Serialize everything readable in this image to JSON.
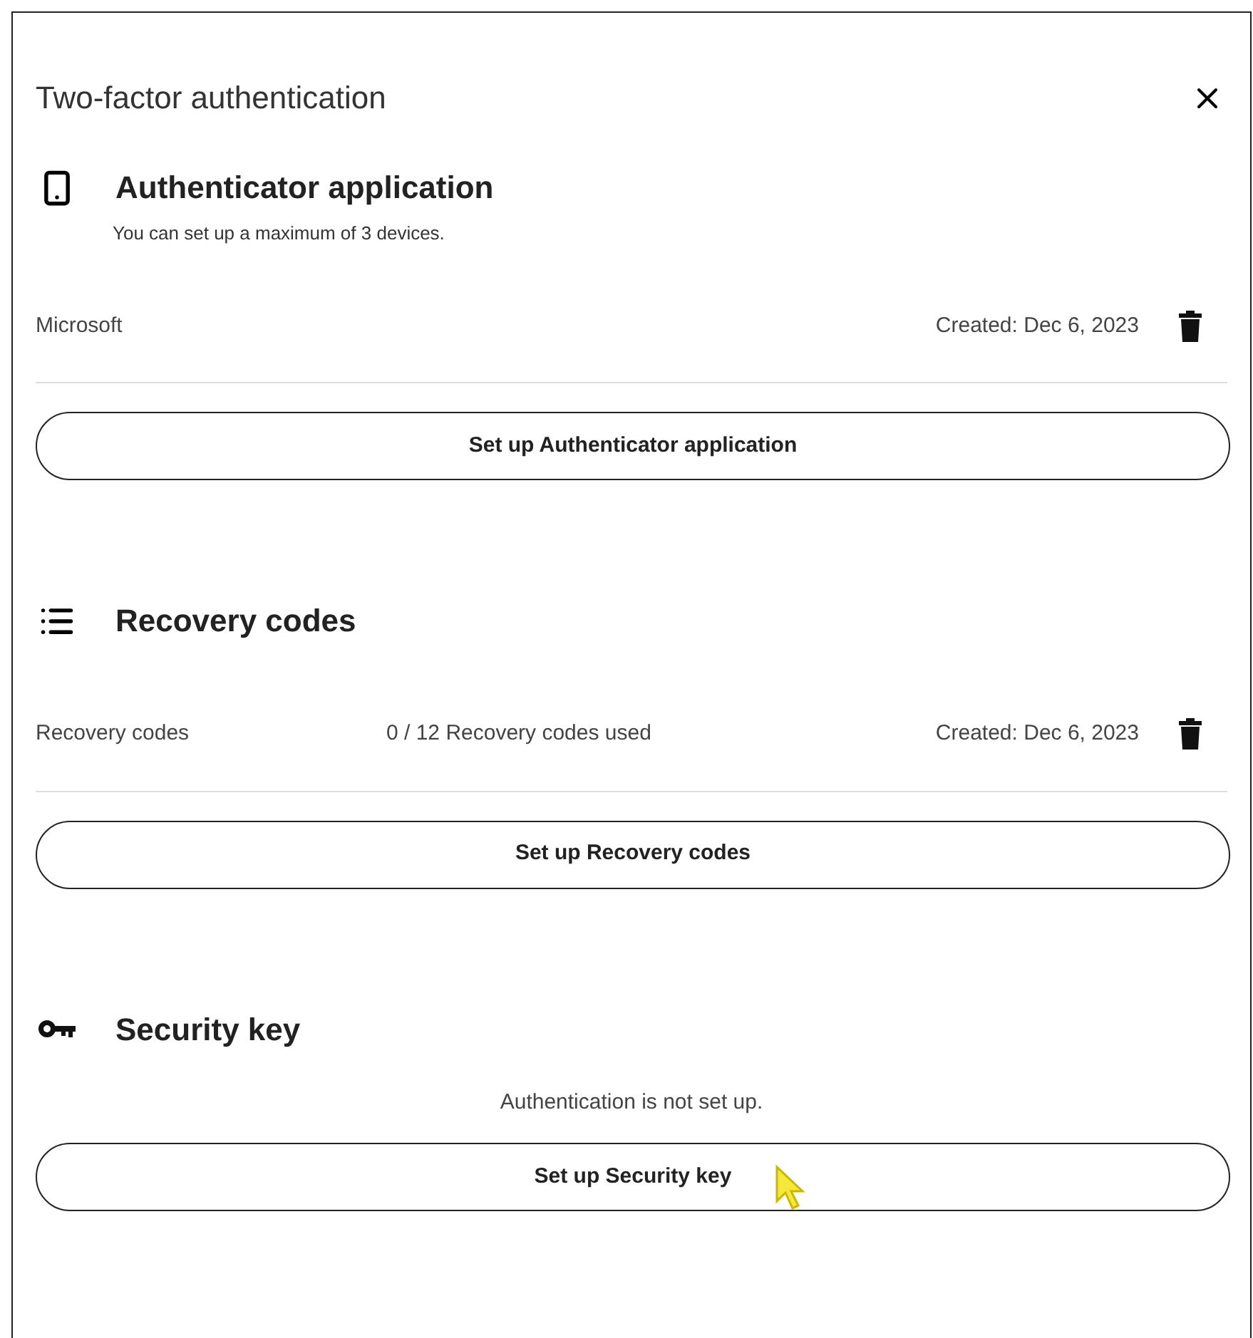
{
  "dialog": {
    "title": "Two-factor authentication"
  },
  "sections": [
    {
      "kind": "phone",
      "heading": "Authenticator application",
      "subtitle": "You can set up a maximum of 3 devices.",
      "rows": [
        {
          "name": "Microsoft",
          "created": "Created: Dec 6, 2023"
        }
      ],
      "button": "Set up Authenticator application"
    },
    {
      "kind": "list",
      "heading": "Recovery codes",
      "rows": [
        {
          "name": "Recovery codes",
          "usage": "0 / 12 Recovery codes used",
          "created": "Created: Dec 6, 2023"
        }
      ],
      "button": "Set up Recovery codes"
    },
    {
      "kind": "key",
      "heading": "Security key",
      "status": "Authentication is not set up.",
      "button": "Set up Security key"
    }
  ]
}
